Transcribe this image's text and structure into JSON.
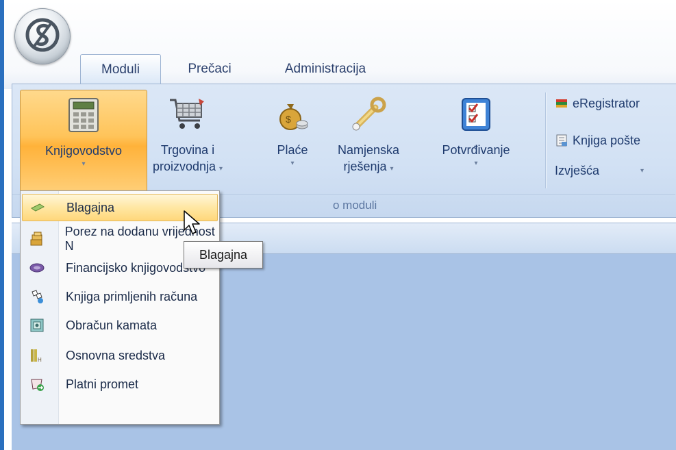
{
  "tabs": [
    "Moduli",
    "Prečaci",
    "Administracija"
  ],
  "ribbon": {
    "buttons": [
      {
        "line1": "Knjigovodstvo",
        "line2": ""
      },
      {
        "line1": "Trgovina i",
        "line2": "proizvodnja"
      },
      {
        "line1": "Plaće",
        "line2": ""
      },
      {
        "line1": "Namjenska",
        "line2": "rješenja"
      },
      {
        "line1": "Potvrđivanje",
        "line2": ""
      }
    ],
    "small_buttons": [
      "eRegistrator",
      "Knjiga pošte",
      "Izvješća"
    ],
    "group_label": "o moduli",
    "dropdown_arrow": "▾"
  },
  "menu": {
    "items": [
      {
        "label": "Blagajna"
      },
      {
        "label": "Porez na dodanu vrijednost N"
      },
      {
        "label": "Financijsko knjigovodstvo"
      },
      {
        "label": "Knjiga primljenih računa"
      },
      {
        "label": "Obračun kamata"
      },
      {
        "label": "Osnovna sredstva"
      },
      {
        "label": "Platni promet"
      }
    ]
  },
  "tooltip": "Blagajna",
  "colors": {
    "accent": "#ffc45a",
    "ribbon": "#d2e1f4",
    "workspace": "#a9c3e6"
  }
}
